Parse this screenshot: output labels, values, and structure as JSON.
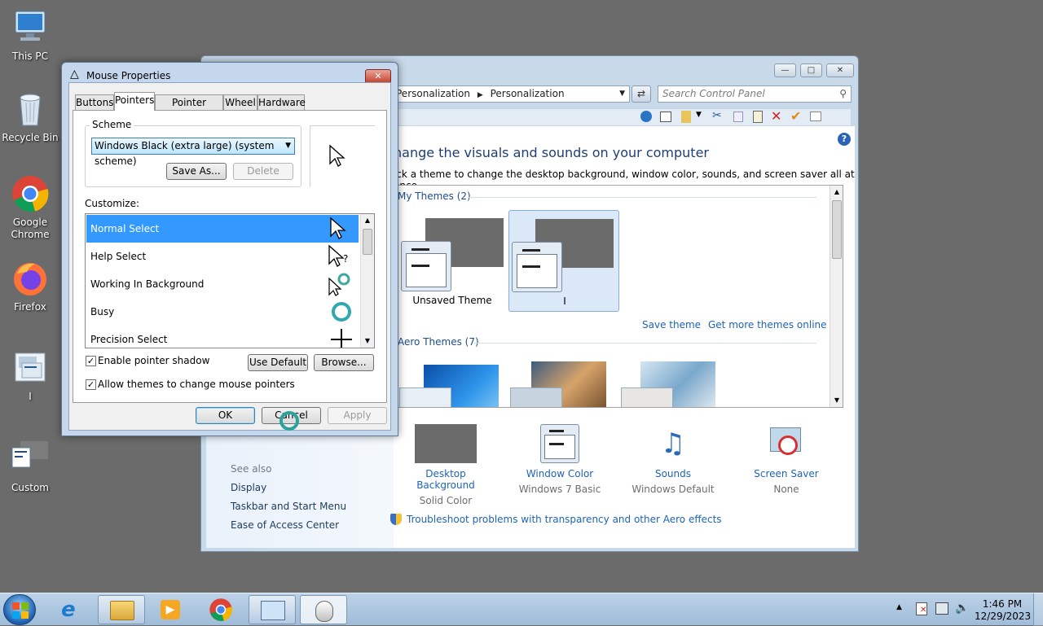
{
  "desktop": {
    "icons": [
      {
        "label": "This PC"
      },
      {
        "label": "Recycle Bin"
      },
      {
        "label": "Google Chrome"
      },
      {
        "label": "Firefox"
      },
      {
        "label": "I"
      },
      {
        "label": "Custom"
      }
    ]
  },
  "control_panel": {
    "breadcrumb_1": "Personalization",
    "breadcrumb_2": "Personalization",
    "search_placeholder": "Search Control Panel",
    "heading": "hange the visuals and sounds on your computer",
    "subheading": "ick a theme to change the desktop background, window color, sounds, and screen saver all at once.",
    "my_themes_header": "My Themes (2)",
    "themes": [
      {
        "name": "Unsaved Theme"
      },
      {
        "name": "I"
      }
    ],
    "save_theme": "Save theme",
    "get_more": "Get more themes online",
    "aero_header": "Aero Themes (7)",
    "see_also": "See also",
    "see_also_links": [
      "Display",
      "Taskbar and Start Menu",
      "Ease of Access Center"
    ],
    "bottom_items": [
      {
        "title": "Desktop Background",
        "sub": "Solid Color"
      },
      {
        "title": "Window Color",
        "sub": "Windows 7 Basic"
      },
      {
        "title": "Sounds",
        "sub": "Windows Default"
      },
      {
        "title": "Screen Saver",
        "sub": "None"
      }
    ],
    "troubleshoot": "Troubleshoot problems with transparency and other Aero effects"
  },
  "mouse_properties": {
    "title": "Mouse Properties",
    "tabs": [
      "Buttons",
      "Pointers",
      "Pointer Options",
      "Wheel",
      "Hardware"
    ],
    "active_tab": "Pointers",
    "scheme_label": "Scheme",
    "scheme_value": "Windows Black (extra large) (system scheme)",
    "save_as": "Save As...",
    "delete": "Delete",
    "customize_label": "Customize:",
    "pointers": [
      {
        "name": "Normal Select",
        "selected": true
      },
      {
        "name": "Help Select",
        "selected": false
      },
      {
        "name": "Working In Background",
        "selected": false
      },
      {
        "name": "Busy",
        "selected": false
      },
      {
        "name": "Precision Select",
        "selected": false
      }
    ],
    "enable_shadow": "Enable pointer shadow",
    "allow_themes": "Allow themes to change mouse pointers",
    "use_default": "Use Default",
    "browse": "Browse...",
    "ok": "OK",
    "cancel": "Cancel",
    "apply": "Apply"
  },
  "taskbar": {
    "time": "1:46 PM",
    "date": "12/29/2023"
  },
  "colors": {
    "desktop": "#6b6b6b",
    "selection": "#3399ff",
    "link": "#1e64b4"
  }
}
